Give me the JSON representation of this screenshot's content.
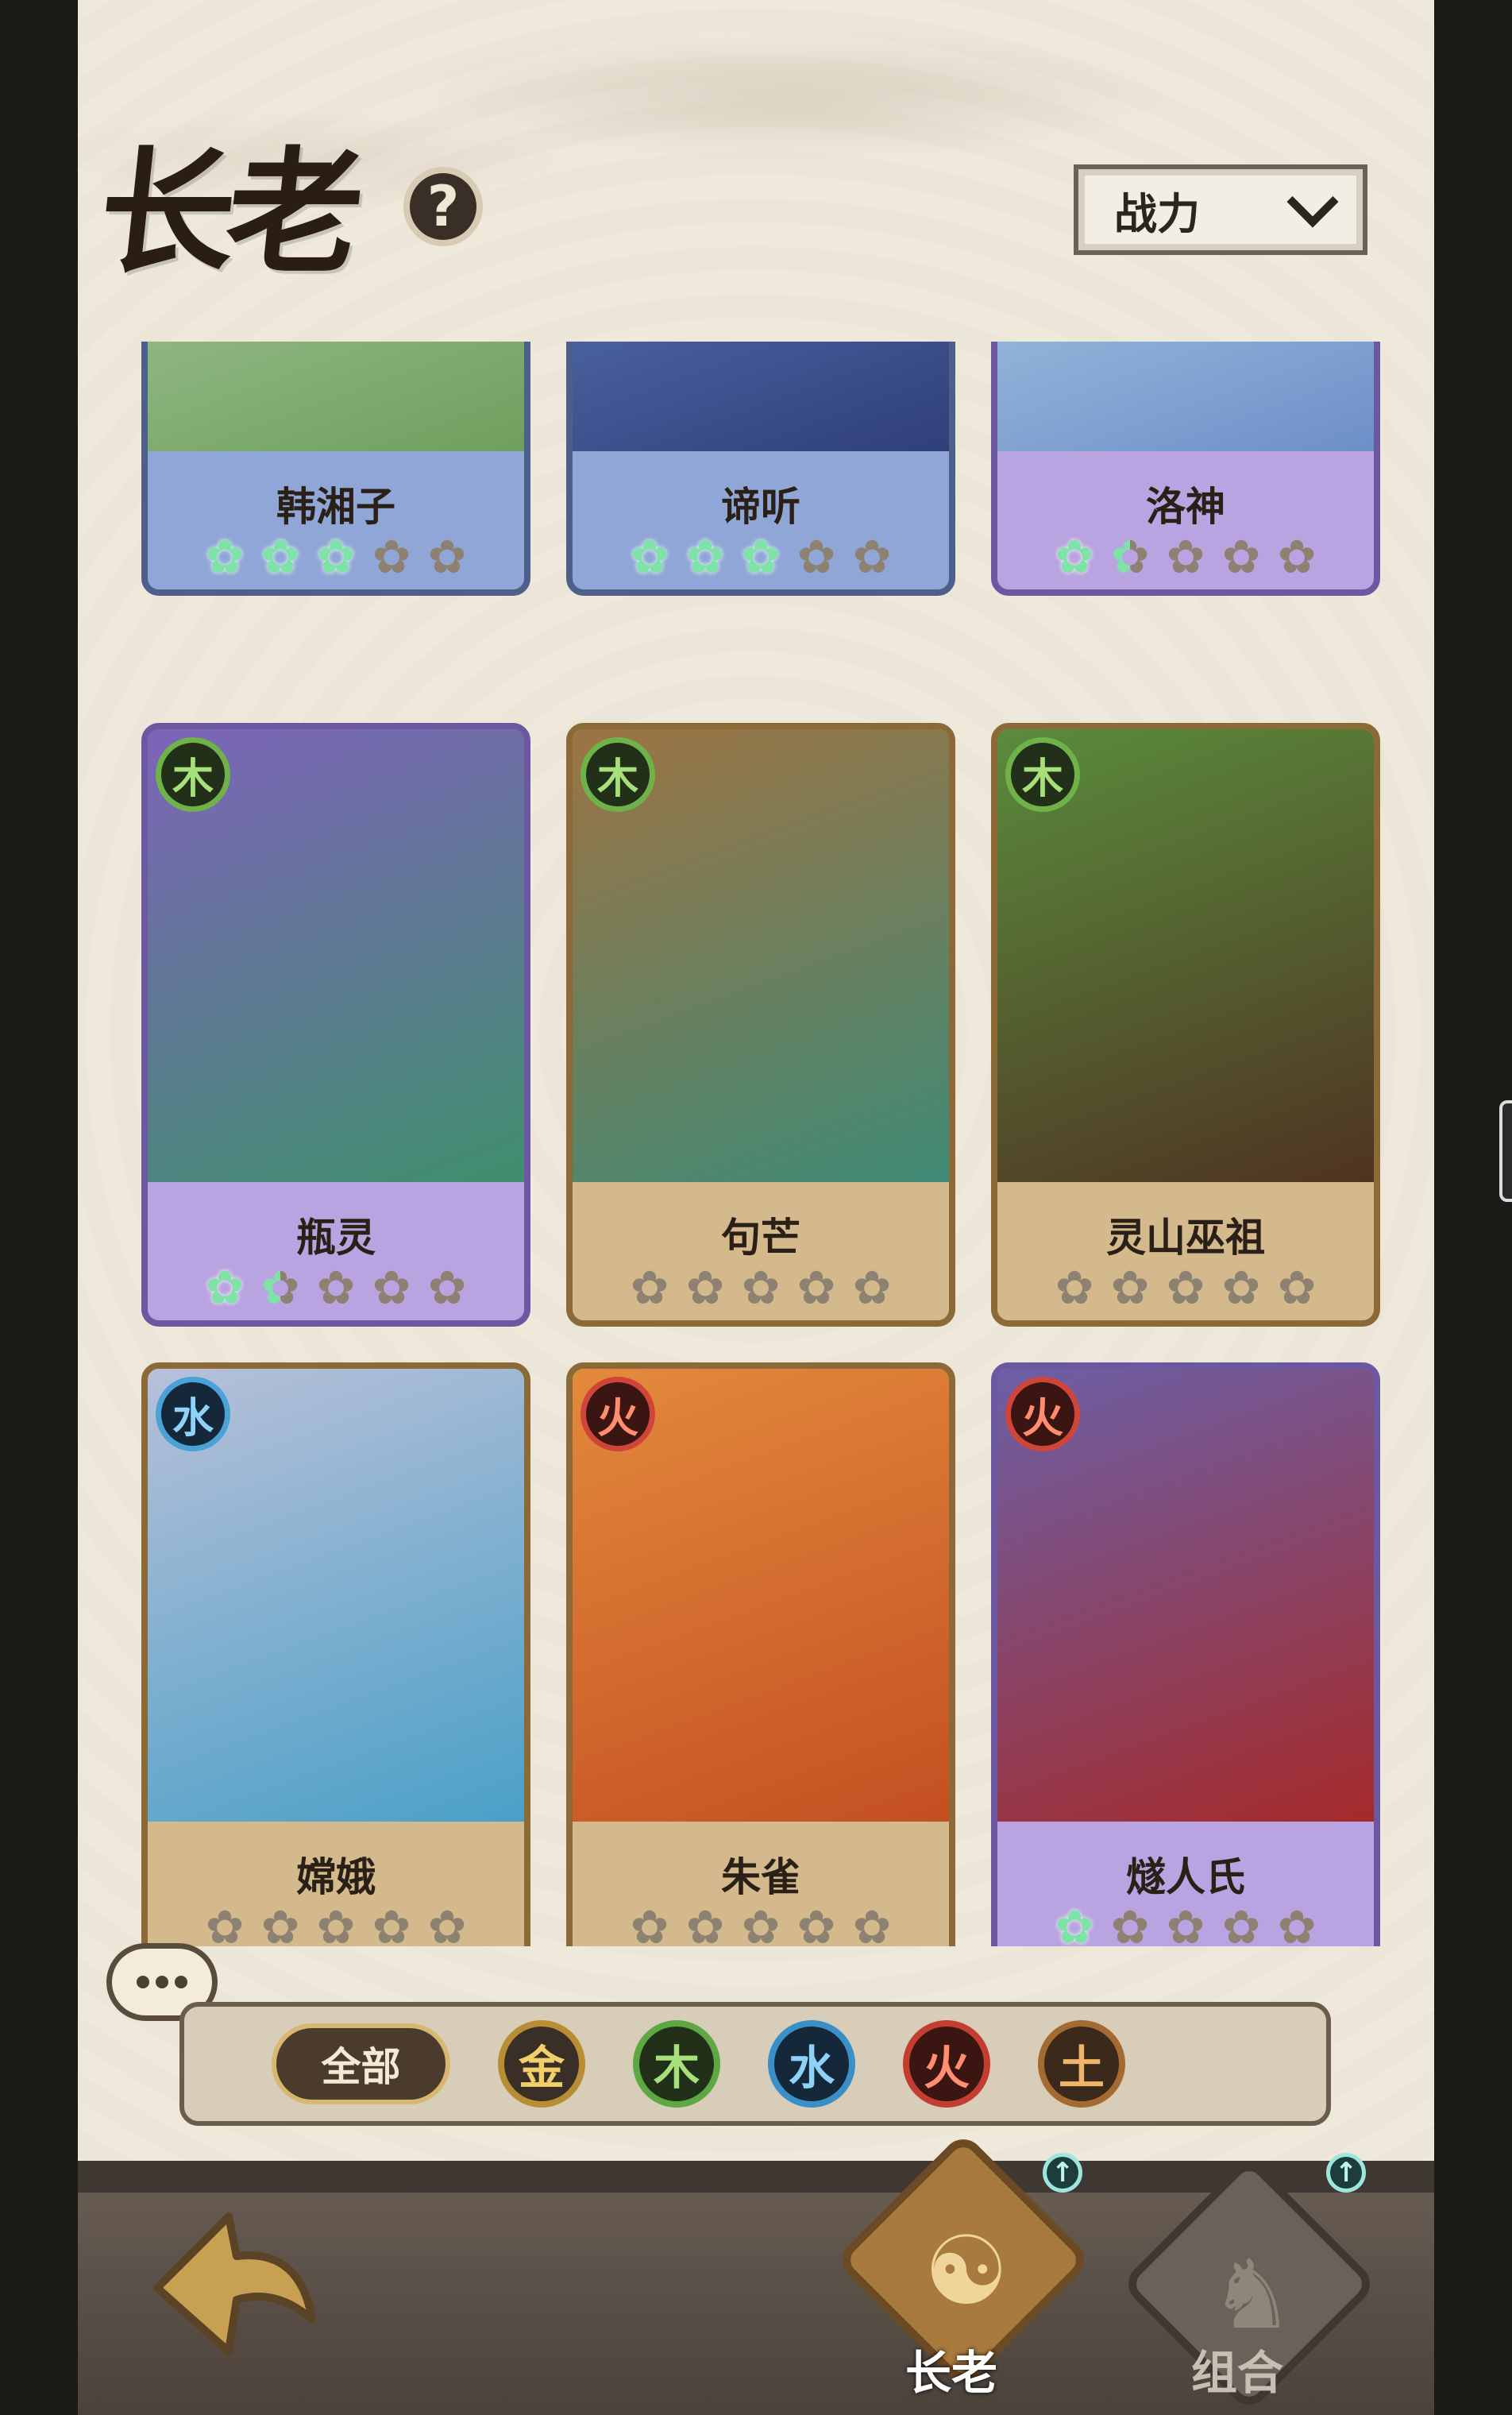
{
  "header": {
    "title": "长老",
    "help_icon": "?",
    "sort_label": "战力"
  },
  "cards": [
    {
      "name": "韩湘子",
      "theme": "blue",
      "element": null,
      "stars": 3,
      "art_top": "#b9d7b0",
      "art_bottom": "#6f9f5e"
    },
    {
      "name": "谛听",
      "theme": "blue",
      "element": null,
      "stars": 3,
      "art_top": "#6c8fd0",
      "art_bottom": "#2f3f7a"
    },
    {
      "name": "洛神",
      "theme": "purple",
      "element": null,
      "stars": 1.5,
      "art_top": "#c8e4f2",
      "art_bottom": "#6d8fc8"
    },
    {
      "name": "瓶灵",
      "theme": "purple",
      "element": "木",
      "element_type": "wood",
      "stars": 1.5,
      "art_top": "#7d64b9",
      "art_bottom": "#3f8e6d"
    },
    {
      "name": "句芒",
      "theme": "gold",
      "element": "木",
      "element_type": "wood",
      "stars": 0,
      "art_top": "#9c7443",
      "art_bottom": "#3f8a76"
    },
    {
      "name": "灵山巫祖",
      "theme": "gold",
      "element": "木",
      "element_type": "wood",
      "stars": 0,
      "art_top": "#5a8c3c",
      "art_bottom": "#4f3322"
    },
    {
      "name": "嫦娥",
      "theme": "gold",
      "element": "水",
      "element_type": "water",
      "stars": 0,
      "art_top": "#b8c0d8",
      "art_bottom": "#4aa0c8"
    },
    {
      "name": "朱雀",
      "theme": "gold",
      "element": "火",
      "element_type": "fire",
      "stars": 0,
      "art_top": "#e38a3c",
      "art_bottom": "#c44f22"
    },
    {
      "name": "燧人氏",
      "theme": "purple",
      "element": "火",
      "element_type": "fire",
      "stars": 1,
      "art_top": "#6c5fa6",
      "art_bottom": "#a52a2a"
    }
  ],
  "filters": {
    "all_label": "全部",
    "gold": "金",
    "wood": "木",
    "water": "水",
    "fire": "火",
    "earth": "土"
  },
  "nav": {
    "elder_label": "长老",
    "combo_label": "组合",
    "up_symbol": "↑"
  }
}
